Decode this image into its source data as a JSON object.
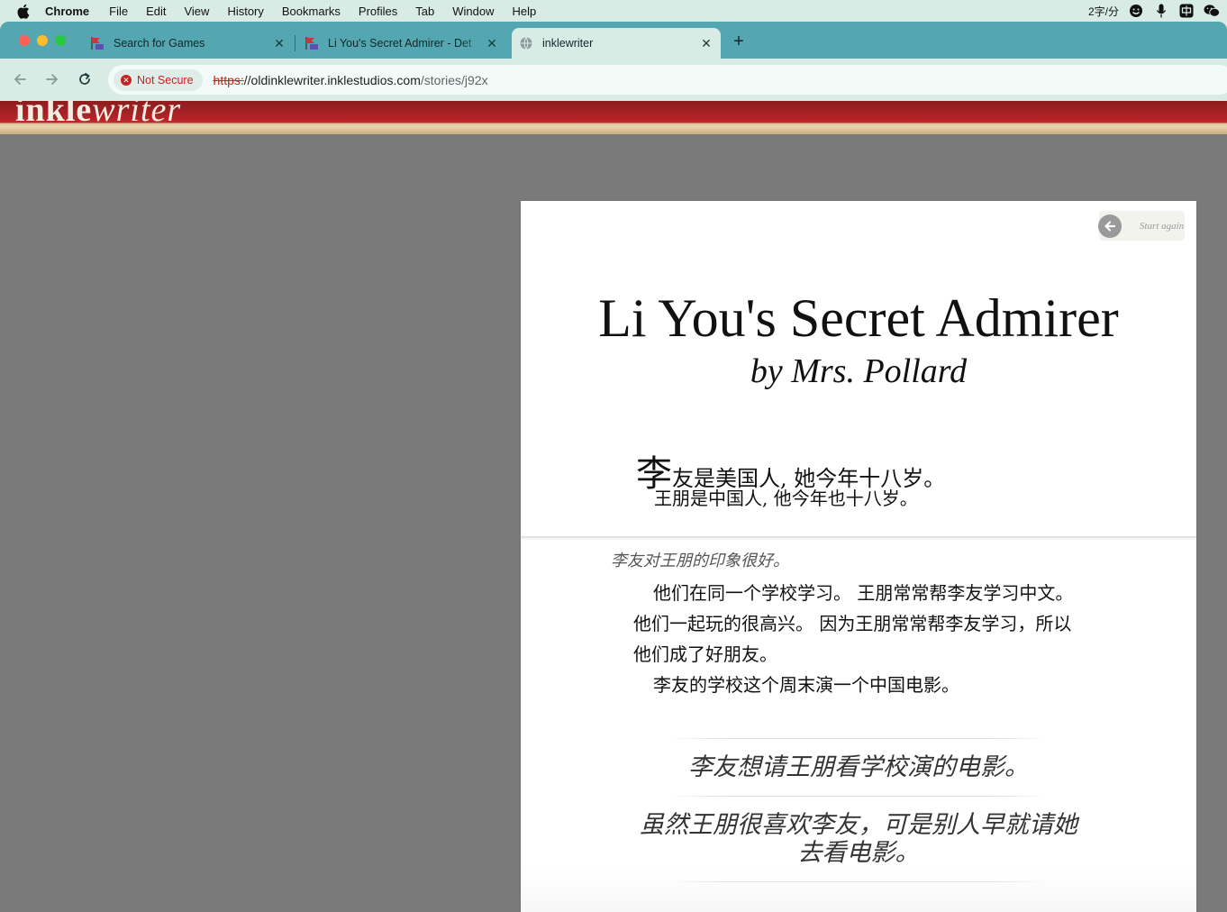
{
  "menubar": {
    "app_name": "Chrome",
    "items": [
      "File",
      "Edit",
      "View",
      "History",
      "Bookmarks",
      "Profiles",
      "Tab",
      "Window",
      "Help"
    ],
    "input_method": "2字/分"
  },
  "tabs": [
    {
      "title": "Search for Games",
      "favicon": "inklewriter-favicon"
    },
    {
      "title": "Li You's Secret Admirer - Det",
      "favicon": "inklewriter-favicon"
    },
    {
      "title": "inklewriter",
      "favicon": "globe-icon",
      "active": true
    }
  ],
  "omnibox": {
    "security_label": "Not Secure",
    "url_scheme": "https:",
    "url_host": "//oldinklewriter.inklestudios.com",
    "url_path": "/stories/j92x"
  },
  "site": {
    "logo_bold": "inkle",
    "logo_italic": "writer"
  },
  "story": {
    "start_again_label": "Start again",
    "title": "Li You's Secret Admirer",
    "author": "by Mrs. Pollard",
    "opening_dropcap": "李",
    "opening_line1_rest": "友是美国人, 她今年十八岁。",
    "opening_line2": "王朋是中国人, 他今年也十八岁。",
    "chosen_option": "李友对王朋的印象很好。",
    "body_p1": "他们在同一个学校学习。 王朋常常帮李友学习中文。 他们一起玩的很高兴。 因为王朋常常帮李友学习，所以他们成了好朋友。",
    "body_p2": "李友的学校这个周末演一个中国电影。",
    "options": [
      "李友想请王朋看学校演的电影。",
      "虽然王朋很喜欢李友，可是别人早就请她去看电影。"
    ]
  },
  "colors": {
    "tabstrip": "#54a7b0",
    "toolbar": "#d8ece5",
    "page_background": "#7a7a7a",
    "banner_red": "#c42a2e",
    "not_secure_red": "#c5221f"
  }
}
